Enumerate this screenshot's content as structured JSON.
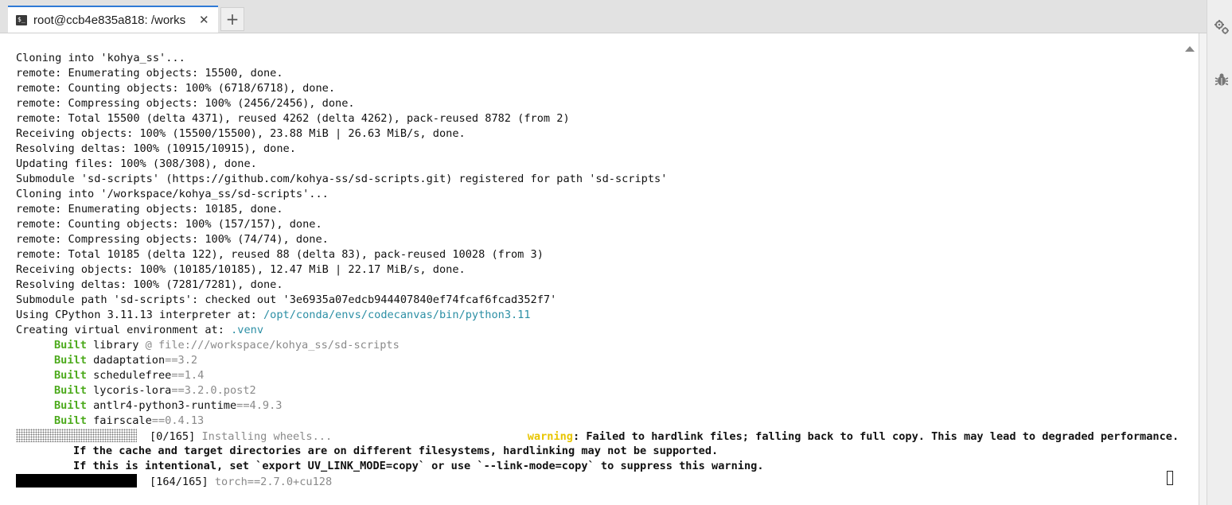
{
  "tab": {
    "icon": "terminal-icon",
    "icon_glyph": "$_",
    "title": "root@ccb4e835a818: /works",
    "close_glyph": "✕",
    "new_tab_glyph": "+"
  },
  "sidebar": {
    "icons": [
      "settings-gears-icon",
      "debug-bug-icon"
    ]
  },
  "terminal": {
    "lines": [
      {
        "segs": [
          {
            "t": "Cloning into 'kohya_ss'..."
          }
        ]
      },
      {
        "segs": [
          {
            "t": "remote: Enumerating objects: 15500, done."
          }
        ]
      },
      {
        "segs": [
          {
            "t": "remote: Counting objects: 100% (6718/6718), done."
          }
        ]
      },
      {
        "segs": [
          {
            "t": "remote: Compressing objects: 100% (2456/2456), done."
          }
        ]
      },
      {
        "segs": [
          {
            "t": "remote: Total 15500 (delta 4371), reused 4262 (delta 4262), pack-reused 8782 (from 2)"
          }
        ]
      },
      {
        "segs": [
          {
            "t": "Receiving objects: 100% (15500/15500), 23.88 MiB | 26.63 MiB/s, done."
          }
        ]
      },
      {
        "segs": [
          {
            "t": "Resolving deltas: 100% (10915/10915), done."
          }
        ]
      },
      {
        "segs": [
          {
            "t": "Updating files: 100% (308/308), done."
          }
        ]
      },
      {
        "segs": [
          {
            "t": "Submodule 'sd-scripts' (https://github.com/kohya-ss/sd-scripts.git) registered for path 'sd-scripts'"
          }
        ]
      },
      {
        "segs": [
          {
            "t": "Cloning into '/workspace/kohya_ss/sd-scripts'..."
          }
        ]
      },
      {
        "segs": [
          {
            "t": "remote: Enumerating objects: 10185, done."
          }
        ]
      },
      {
        "segs": [
          {
            "t": "remote: Counting objects: 100% (157/157), done."
          }
        ]
      },
      {
        "segs": [
          {
            "t": "remote: Compressing objects: 100% (74/74), done."
          }
        ]
      },
      {
        "segs": [
          {
            "t": "remote: Total 10185 (delta 122), reused 88 (delta 83), pack-reused 10028 (from 3)"
          }
        ]
      },
      {
        "segs": [
          {
            "t": "Receiving objects: 100% (10185/10185), 12.47 MiB | 22.17 MiB/s, done."
          }
        ]
      },
      {
        "segs": [
          {
            "t": "Resolving deltas: 100% (7281/7281), done."
          }
        ]
      },
      {
        "segs": [
          {
            "t": "Submodule path 'sd-scripts': checked out '3e6935a07edcb944407840ef74fcaf6fcad352f7'"
          }
        ]
      },
      {
        "segs": [
          {
            "t": "Using CPython 3.11.13 interpreter at: "
          },
          {
            "t": "/opt/conda/envs/codecanvas/bin/python3.11",
            "c": "cyan"
          }
        ]
      },
      {
        "segs": [
          {
            "t": "Creating virtual environment at: "
          },
          {
            "t": ".venv",
            "c": "cyan"
          }
        ]
      },
      {
        "indent": "ind6",
        "segs": [
          {
            "t": "Built",
            "c": "green"
          },
          {
            "t": " library "
          },
          {
            "t": "@ file:///workspace/kohya_ss/sd-scripts",
            "c": "dim"
          }
        ]
      },
      {
        "indent": "ind6",
        "segs": [
          {
            "t": "Built",
            "c": "green"
          },
          {
            "t": " dadaptation"
          },
          {
            "t": "==3.2",
            "c": "dim"
          }
        ]
      },
      {
        "indent": "ind6",
        "segs": [
          {
            "t": "Built",
            "c": "green"
          },
          {
            "t": " schedulefree"
          },
          {
            "t": "==1.4",
            "c": "dim"
          }
        ]
      },
      {
        "indent": "ind6",
        "segs": [
          {
            "t": "Built",
            "c": "green"
          },
          {
            "t": " lycoris-lora"
          },
          {
            "t": "==3.2.0.post2",
            "c": "dim"
          }
        ]
      },
      {
        "indent": "ind6",
        "segs": [
          {
            "t": "Built",
            "c": "green"
          },
          {
            "t": " antlr4-python3-runtime"
          },
          {
            "t": "==4.9.3",
            "c": "dim"
          }
        ]
      },
      {
        "indent": "ind6",
        "segs": [
          {
            "t": "Built",
            "c": "green"
          },
          {
            "t": " fairscale"
          },
          {
            "t": "==0.4.13",
            "c": "dim"
          }
        ]
      },
      {
        "bar": "dotted",
        "segs": [
          {
            "t": "[0/165] "
          },
          {
            "t": "Installing wheels...",
            "c": "dim"
          },
          {
            "t": "                              "
          },
          {
            "t": "warning",
            "c": "yellow bold"
          },
          {
            "t": ": Failed to hardlink files; falling back to full copy. This may lead to degraded performance.",
            "c": "bold"
          }
        ]
      },
      {
        "indent": "ind9",
        "segs": [
          {
            "t": "If the cache and target directories are on different filesystems, hardlinking may not be supported.",
            "c": "bold"
          }
        ]
      },
      {
        "indent": "ind9",
        "segs": [
          {
            "t": "If this is intentional, set `export UV_LINK_MODE=copy` or use `--link-mode=copy` to suppress this warning.",
            "c": "bold"
          }
        ]
      },
      {
        "bar": "solid",
        "segs": [
          {
            "t": "[164/165] "
          },
          {
            "t": "torch==2.7.0+cu128",
            "c": "dim"
          }
        ]
      }
    ]
  },
  "progress": {
    "wheels_install_fraction": 0.0,
    "torch_install_fraction": 0.994
  }
}
